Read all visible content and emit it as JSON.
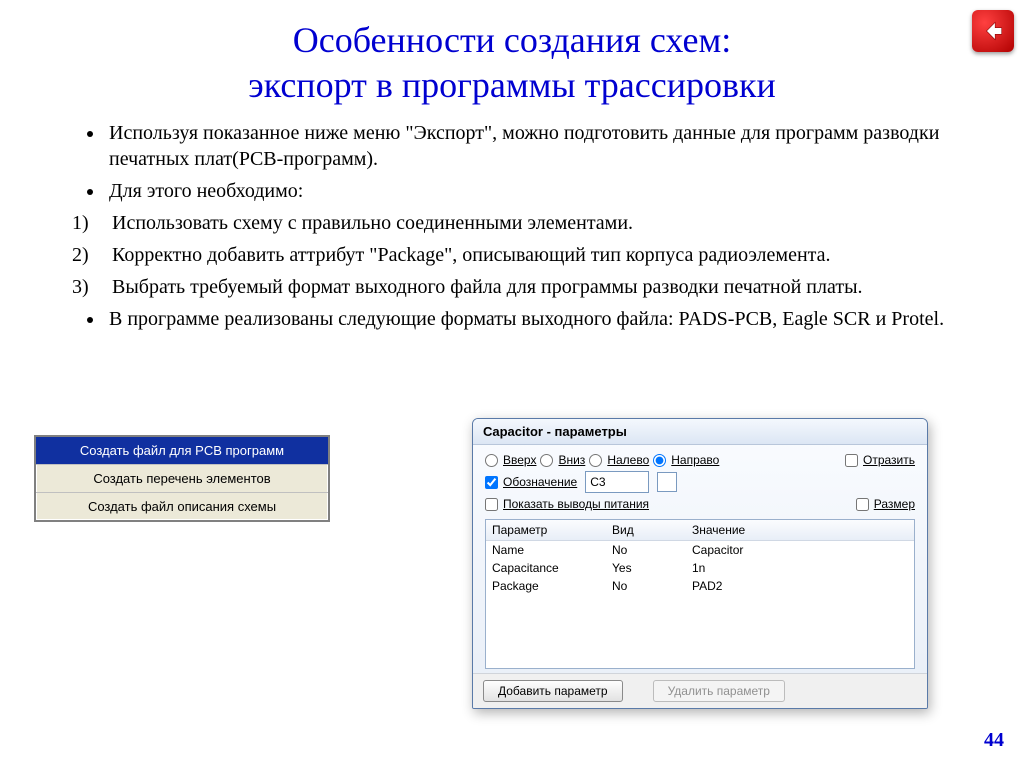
{
  "title_line1": "Особенности создания схем:",
  "title_line2": "экспорт в программы трассировки",
  "bullets_top": [
    "Используя показанное ниже меню \"Экспорт\", можно подготовить данные для программ разводки печатных плат(PCB-программ).",
    "Для этого необходимо:"
  ],
  "numbered": [
    "Использовать схему с правильно соединенными элементами.",
    "Корректно добавить аттрибут \"Package\", описывающий тип корпуса радиоэлемента.",
    "Выбрать требуемый формат выходного файла для программы разводки печатной платы."
  ],
  "bullets_bottom": [
    "В программе реализованы следующие форматы выходного файла: PADS-PCB, Eagle SCR и Protel."
  ],
  "export_menu": {
    "items": [
      "Создать файл для PCB программ",
      "Создать перечень элементов",
      "Создать файл описания схемы"
    ]
  },
  "dialog": {
    "title": "Capacitor - параметры",
    "radios": {
      "up": "Вверх",
      "down": "Вниз",
      "left": "Налево",
      "right": "Направо"
    },
    "mirror": "Отразить",
    "designation_label": "Обозначение",
    "designation_value": "C3",
    "show_power": "Показать выводы питания",
    "size_label": "Размер",
    "table": {
      "headers": {
        "param": "Параметр",
        "kind": "Вид",
        "value": "Значение"
      },
      "rows": [
        {
          "param": "Name",
          "kind": "No",
          "value": "Capacitor"
        },
        {
          "param": "Capacitance",
          "kind": "Yes",
          "value": "1n"
        },
        {
          "param": "Package",
          "kind": "No",
          "value": "PAD2"
        }
      ]
    },
    "buttons": {
      "add": "Добавить параметр",
      "del": "Удалить параметр"
    }
  },
  "page_number": "44"
}
